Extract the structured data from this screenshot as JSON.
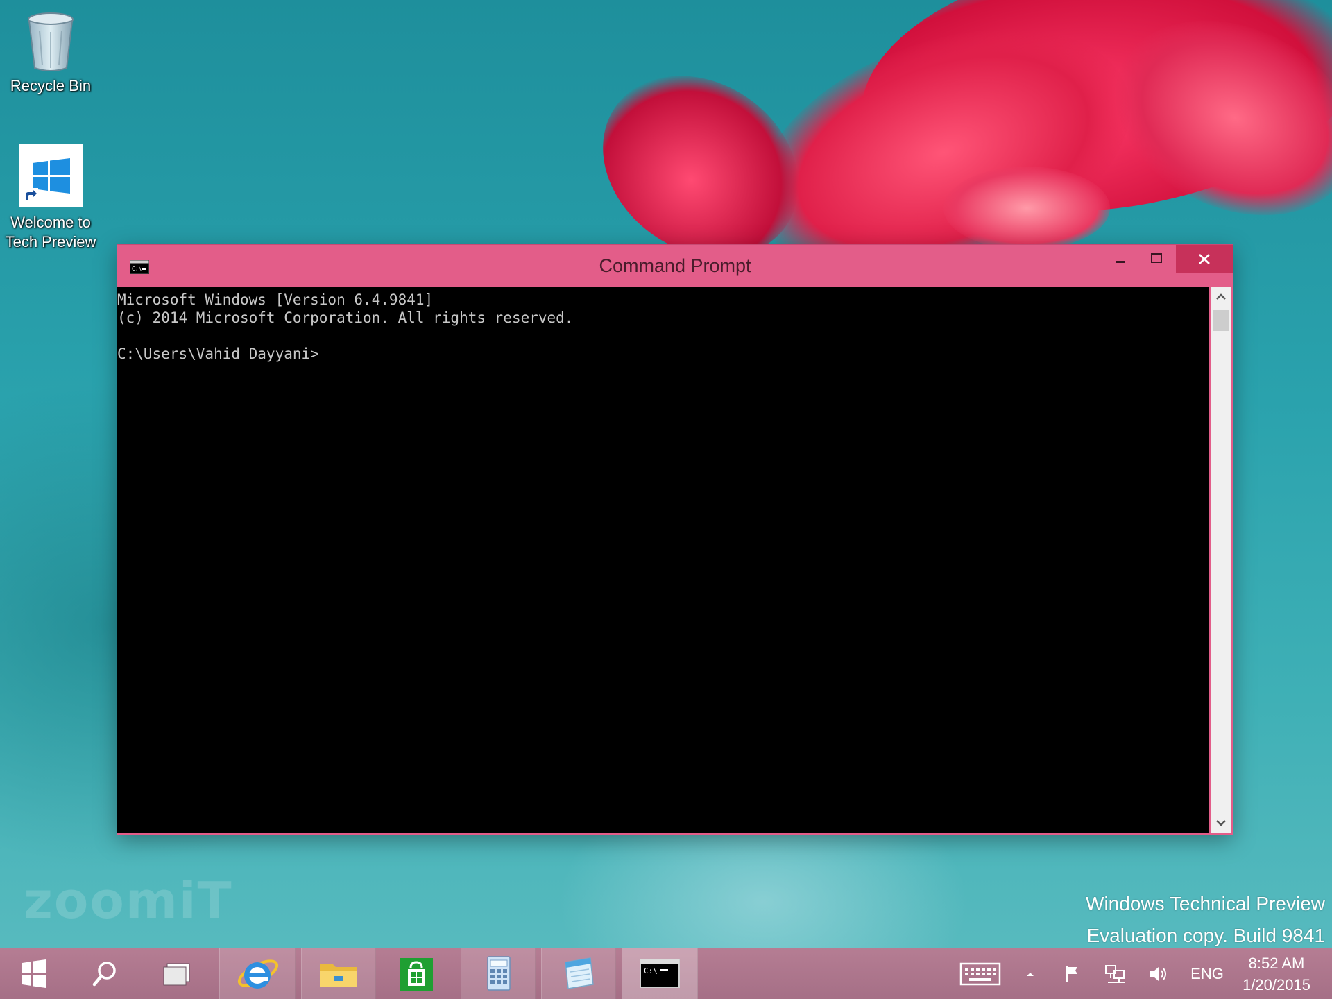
{
  "desktop": {
    "icons": [
      {
        "label": "Recycle Bin"
      },
      {
        "label_line1": "Welcome to",
        "label_line2": "Tech Preview"
      }
    ],
    "watermark": "zoomiT",
    "evaluation": {
      "line1": "Windows Technical Preview",
      "line2": "Evaluation copy. Build 9841"
    }
  },
  "window": {
    "title": "Command Prompt",
    "console_lines": [
      "Microsoft Windows [Version 6.4.9841]",
      "(c) 2014 Microsoft Corporation. All rights reserved.",
      "",
      "C:\\Users\\Vahid Dayyani>"
    ],
    "accent_color": "#e35d89",
    "close_color": "#c7315a"
  },
  "taskbar": {
    "pinned": [
      "start",
      "search",
      "task-view",
      "internet-explorer",
      "file-explorer",
      "store",
      "calculator",
      "notepad",
      "command-prompt"
    ],
    "active": "command-prompt",
    "tray": {
      "language": "ENG"
    },
    "clock": {
      "time": "8:52 AM",
      "date": "1/20/2015"
    }
  }
}
